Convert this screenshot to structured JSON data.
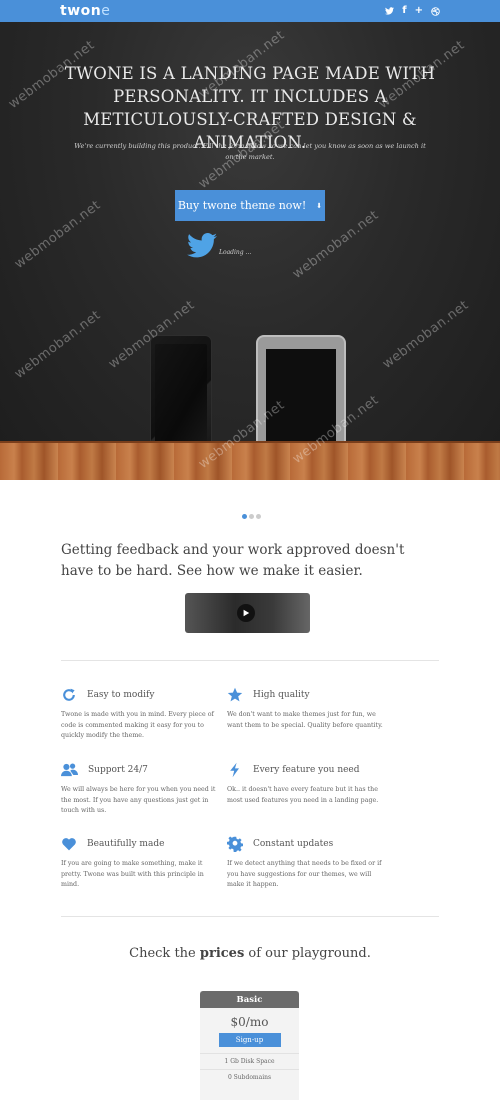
{
  "brand": {
    "name_main": "twon",
    "name_accent": "e"
  },
  "social": {
    "icons": [
      "twitter-icon",
      "facebook-icon",
      "google-plus-icon",
      "dribbble-icon"
    ],
    "facebook_glyph": "f",
    "gplus_glyph": "+"
  },
  "hero": {
    "title": "TWONE IS A LANDING PAGE MADE WITH PERSONALITY. IT INCLUDES A METICULOUSLY-CRAFTED DESIGN & ANIMATION.",
    "subtitle": "We're currently building this product. Fill the form below so we can let you know as soon as we launch it on the market.",
    "cta_label": "Buy twone theme now!",
    "cta_icon": "download-icon",
    "tweet_status": "Loading ..."
  },
  "slider": {
    "count": 3,
    "active": 0
  },
  "feedback": {
    "text": "Getting feedback and your work approved doesn't have to be hard. See how we make it easier."
  },
  "features": [
    {
      "icon": "refresh-icon",
      "title": "Easy to modify",
      "desc": "Twone is made with you in mind. Every piece of code is commented making it easy for you to quickly modify the theme."
    },
    {
      "icon": "star-icon",
      "title": "High quality",
      "desc": "We don't want to make themes just for fun, we want them to be special. Quality before quantity."
    },
    {
      "icon": "users-icon",
      "title": "Support 24/7",
      "desc": "We will always be here for you when you need it the most. If you have any questions just get in touch with us."
    },
    {
      "icon": "bolt-icon",
      "title": "Every feature you need",
      "desc": "Ok.. it doesn't have every feature but it has the most used features you need in a landing page."
    },
    {
      "icon": "heart-icon",
      "title": "Beautifully made",
      "desc": "If you are going to make something, make it pretty. Twone was built with this principle in mind."
    },
    {
      "icon": "gear-icon",
      "title": "Constant updates",
      "desc": "If we detect anything that needs to be fixed or if you have suggestions for our themes, we will make it happen."
    }
  ],
  "prices": {
    "title_before": "Check the ",
    "title_bold": "prices",
    "title_after": " of our playground.",
    "plan": {
      "name": "Basic",
      "price": "$0/mo",
      "button": "Sign-up",
      "features": [
        "1 Gb Disk Space",
        "0 Subdomains"
      ]
    }
  },
  "watermark": "webmoban.net",
  "colors": {
    "accent": "#4a90d9",
    "hero_bg": "#2a2a2a",
    "wood": "#b86a38",
    "text": "#555555"
  }
}
